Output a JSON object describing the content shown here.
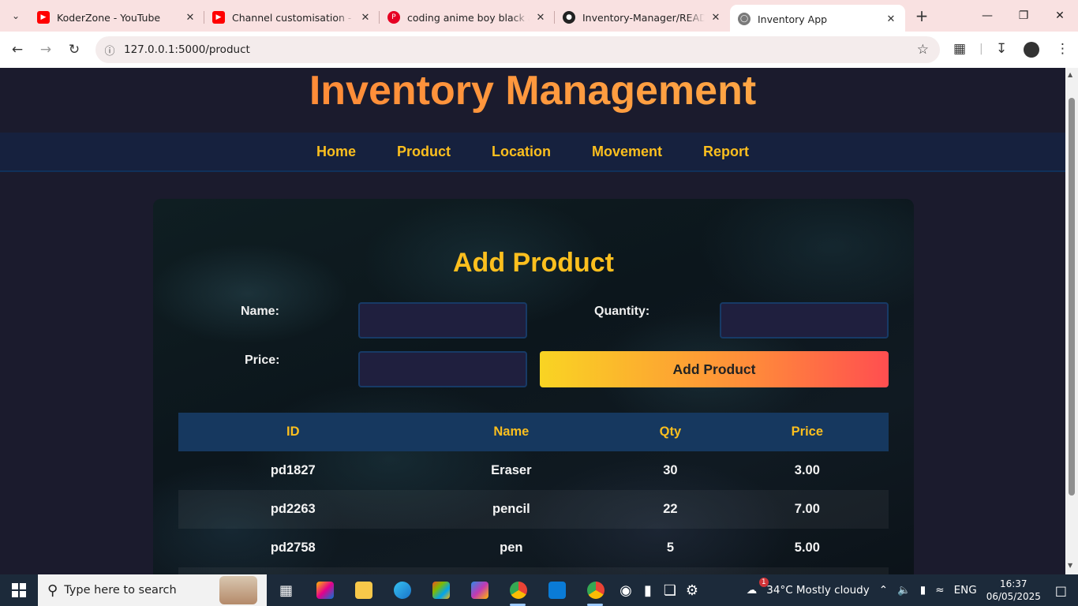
{
  "browser": {
    "tabs": [
      {
        "title": "KoderZone - YouTube",
        "icon": "youtube-icon",
        "active": false
      },
      {
        "title": "Channel customisation - YouTube Studio",
        "icon": "youtube-icon",
        "active": false
      },
      {
        "title": "coding anime boy black and white",
        "icon": "pinterest-icon",
        "active": false
      },
      {
        "title": "Inventory-Manager/README.md",
        "icon": "github-icon",
        "active": false
      },
      {
        "title": "Inventory App",
        "icon": "globe-icon",
        "active": true
      }
    ],
    "url": "127.0.0.1:5000/product"
  },
  "page": {
    "title": "Inventory Management",
    "nav": [
      "Home",
      "Product",
      "Location",
      "Movement",
      "Report"
    ],
    "form": {
      "heading": "Add Product",
      "name_label": "Name:",
      "quantity_label": "Quantity:",
      "price_label": "Price:",
      "name_value": "",
      "quantity_value": "",
      "price_value": "",
      "submit_label": "Add Product"
    },
    "table": {
      "headers": [
        "ID",
        "Name",
        "Qty",
        "Price"
      ],
      "rows": [
        [
          "pd1827",
          "Eraser",
          "30",
          "3.00"
        ],
        [
          "pd2263",
          "pencil",
          "22",
          "7.00"
        ],
        [
          "pd2758",
          "pen",
          "5",
          "5.00"
        ]
      ]
    }
  },
  "taskbar": {
    "search_placeholder": "Type here to search",
    "weather": "34°C  Mostly cloudy",
    "weather_badge": "1",
    "language": "ENG",
    "time": "16:37",
    "date": "06/05/2025"
  },
  "colors": {
    "accent": "#fcbf1e",
    "title_gradient_start": "#ff7a2f",
    "title_gradient_end": "#ffb74d",
    "page_bg": "#1b1b2d",
    "nav_bg": "#16213e",
    "table_header_bg": "#16385f"
  }
}
